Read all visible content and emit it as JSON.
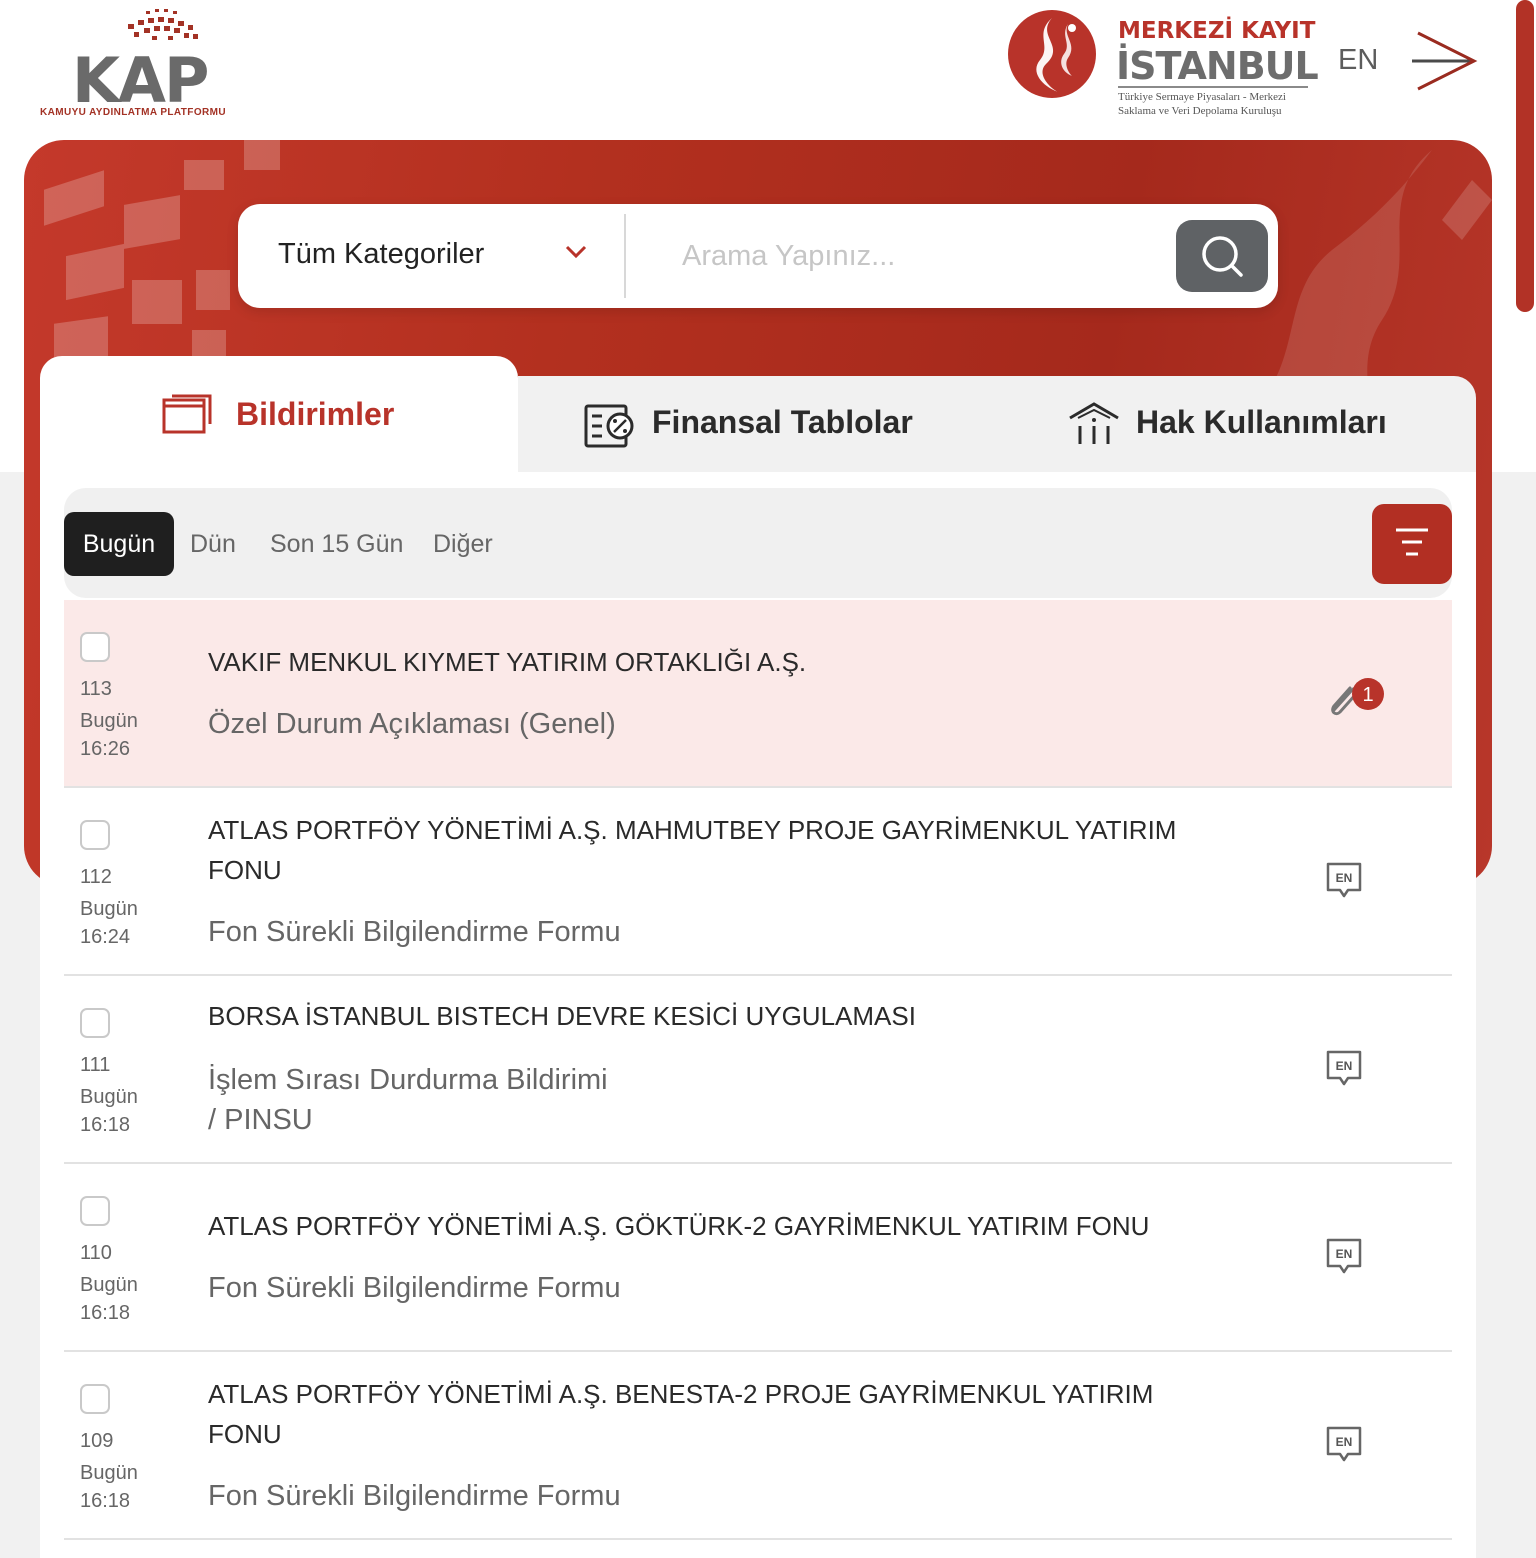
{
  "header": {
    "kap_logo_text": "KAP",
    "kap_logo_sub": "KAMUYU AYDINLATMA PLATFORMU",
    "mkk_line1": "MERKEZİ KAYIT",
    "mkk_line2": "İSTANBUL",
    "mkk_line3": "Türkiye Sermaye Piyasaları - Merkezi Saklama ve Veri Depolama Kuruluşu",
    "lang_label": "EN",
    "menu_icon": "arrow-right-icon"
  },
  "search": {
    "category_label": "Tüm Kategoriler",
    "placeholder": "Arama Yapınız...",
    "value": ""
  },
  "tabs": {
    "notifications": "Bildirimler",
    "financial": "Finansal Tablolar",
    "rights": "Hak Kullanımları"
  },
  "filters": {
    "today": "Bugün",
    "yesterday": "Dün",
    "last15": "Son 15 Gün",
    "other": "Diğer"
  },
  "notifications": [
    {
      "num": "113",
      "day": "Bugün",
      "time": "16:26",
      "title": "VAKIF MENKUL KIYMET YATIRIM ORTAKLIĞI A.Ş.",
      "subtitle": "Özel Durum Açıklaması (Genel)",
      "action": "attachment",
      "attachment_count": "1"
    },
    {
      "num": "112",
      "day": "Bugün",
      "time": "16:24",
      "title": "ATLAS PORTFÖY YÖNETİMİ A.Ş. MAHMUTBEY PROJE GAYRİMENKUL YATIRIM FONU",
      "subtitle": "Fon Sürekli Bilgilendirme Formu",
      "action": "EN"
    },
    {
      "num": "111",
      "day": "Bugün",
      "time": "16:18",
      "title": "BORSA İSTANBUL BISTECH DEVRE KESİCİ UYGULAMASI",
      "subtitle": "İşlem Sırası Durdurma Bildirimi",
      "subtitle2": "/ PINSU",
      "action": "EN"
    },
    {
      "num": "110",
      "day": "Bugün",
      "time": "16:18",
      "title": "ATLAS PORTFÖY YÖNETİMİ A.Ş. GÖKTÜRK-2 GAYRİMENKUL YATIRIM FONU",
      "subtitle": "Fon Sürekli Bilgilendirme Formu",
      "action": "EN"
    },
    {
      "num": "109",
      "day": "Bugün",
      "time": "16:18",
      "title": "ATLAS PORTFÖY YÖNETİMİ A.Ş. BENESTA-2 PROJE GAYRİMENKUL YATIRIM FONU",
      "subtitle": "Fon Sürekli Bilgilendirme Formu",
      "action": "EN"
    }
  ],
  "colors": {
    "brand_red": "#b8332a",
    "highlight_row": "#fbe9e8",
    "active_filter": "#1f1f1f"
  }
}
